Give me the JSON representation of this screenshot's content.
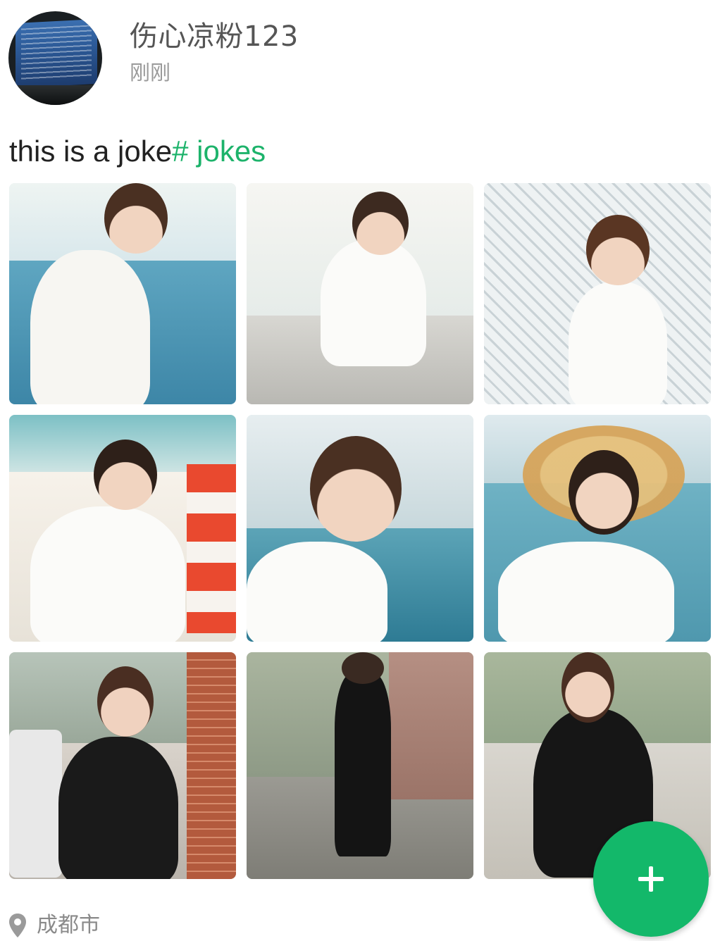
{
  "post": {
    "author": {
      "name": "伤心凉粉123",
      "avatar_icon": "avatar-laptop-screen"
    },
    "timestamp": "刚刚",
    "content": {
      "text": "this is a joke",
      "hashtag": "# jokes"
    },
    "photos": [
      {
        "id": "p1"
      },
      {
        "id": "p2"
      },
      {
        "id": "p3"
      },
      {
        "id": "p4"
      },
      {
        "id": "p5"
      },
      {
        "id": "p6"
      },
      {
        "id": "p7"
      },
      {
        "id": "p8"
      },
      {
        "id": "p9"
      }
    ],
    "location": {
      "label": "成都市",
      "icon": "location-pin-icon"
    }
  },
  "fab": {
    "icon": "plus-icon"
  },
  "colors": {
    "accent": "#13b86a",
    "hashtag": "#1db36b",
    "name_text": "#555555",
    "secondary_text": "#9a9a9a"
  }
}
